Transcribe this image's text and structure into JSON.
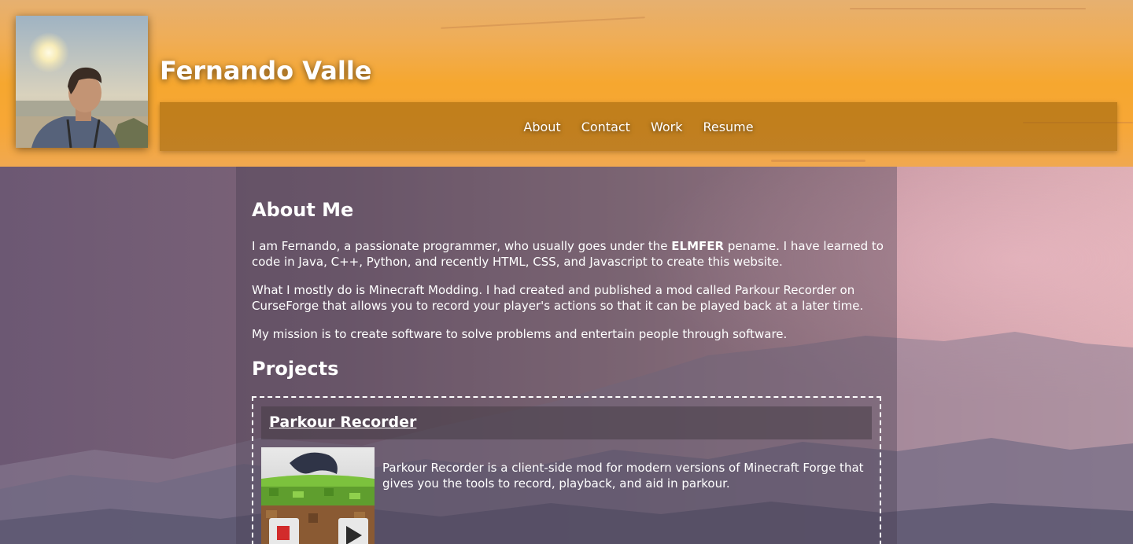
{
  "header": {
    "name": "Fernando Valle",
    "nav": [
      {
        "label": "About"
      },
      {
        "label": "Contact"
      },
      {
        "label": "Work"
      },
      {
        "label": "Resume"
      }
    ]
  },
  "about": {
    "heading": "About Me",
    "p1_before": "I am Fernando, a passionate programmer, who usually goes under the ",
    "p1_bold": "ELMFER",
    "p1_after": " pename. I have learned to code in Java, C++, Python, and recently HTML, CSS, and Javascript to create this website.",
    "p2": "What I mostly do is Minecraft Modding. I had created and published a mod called Parkour Recorder on CurseForge that allows you to record your player's actions so that it can be played back at a later time.",
    "p3": "My mission is to create software to solve problems and entertain people through software."
  },
  "projects": {
    "heading": "Projects",
    "items": [
      {
        "title": "Parkour Recorder",
        "description": "Parkour Recorder is a client-side mod for modern versions of Minecraft Forge that gives you the tools to record, playback, and aid in parkour."
      }
    ]
  }
}
